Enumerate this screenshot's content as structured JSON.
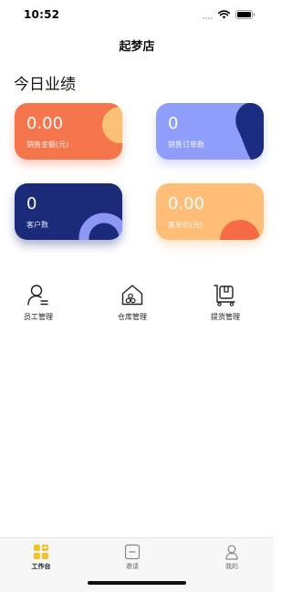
{
  "status_bar": {
    "time": "10:52"
  },
  "nav": {
    "title": "起梦店"
  },
  "dashboard": {
    "section_title": "今日业绩",
    "cards": {
      "sales": {
        "value": "0.00",
        "label": "销售金额(元)",
        "color": "#f5754c"
      },
      "orders": {
        "value": "0",
        "label": "销售订单数",
        "color": "#8f9dfb"
      },
      "customers": {
        "value": "0",
        "label": "客户数",
        "color": "#1c2a7a"
      },
      "avg_price": {
        "value": "0.00",
        "label": "客单价(元)",
        "color": "#ffbd78"
      }
    }
  },
  "shortcuts": [
    {
      "label": "员工管理",
      "icon": "employee-icon"
    },
    {
      "label": "仓库管理",
      "icon": "warehouse-icon"
    },
    {
      "label": "提货管理",
      "icon": "pickup-cart-icon"
    }
  ],
  "tab_bar": {
    "tabs": [
      {
        "label": "工作台",
        "icon": "workbench-grid-icon",
        "active": true
      },
      {
        "label": "邀请",
        "icon": "invite-icon",
        "active": false
      },
      {
        "label": "我的",
        "icon": "profile-icon",
        "active": false
      }
    ],
    "accent_color": "#f5c22e"
  }
}
